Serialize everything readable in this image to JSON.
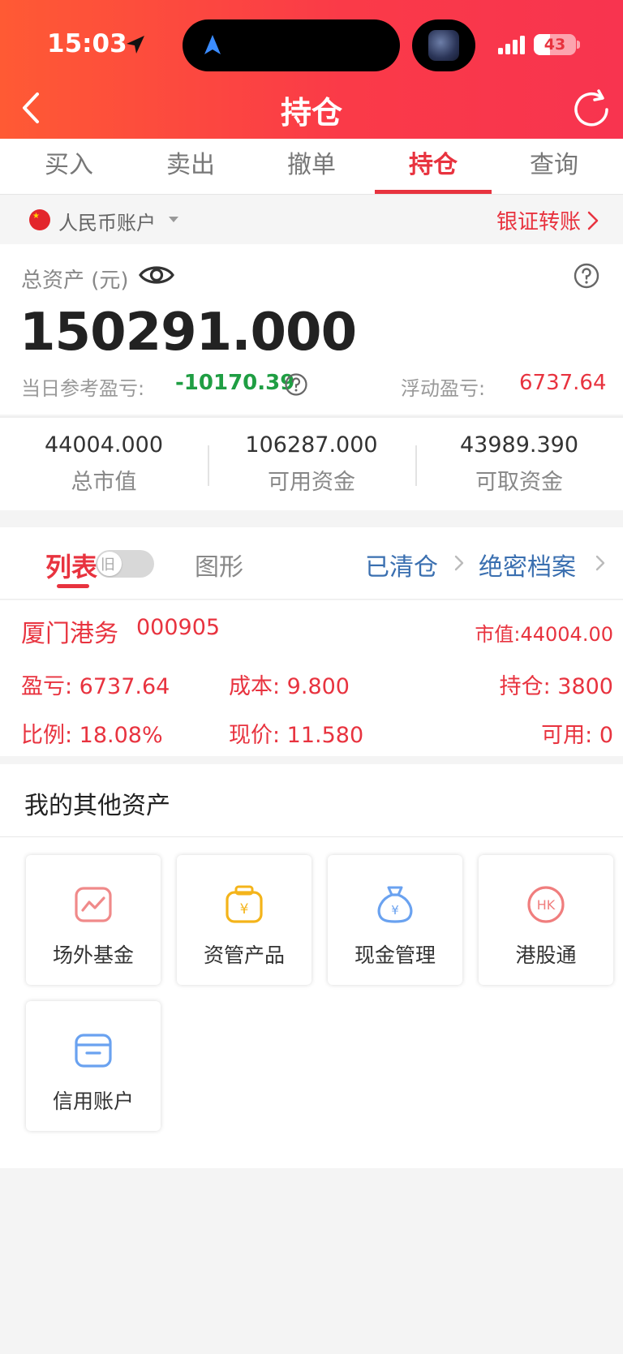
{
  "status_bar": {
    "time": "15:03",
    "battery": "43"
  },
  "header": {
    "title": "持仓"
  },
  "tabs": [
    {
      "label": "买入"
    },
    {
      "label": "卖出"
    },
    {
      "label": "撤单"
    },
    {
      "label": "持仓",
      "active": true
    },
    {
      "label": "查询"
    }
  ],
  "account": {
    "name": "人民币账户",
    "transfer_label": "银证转账"
  },
  "assets": {
    "label": "总资产 (元)",
    "total": "150291.000",
    "daily_pnl_label": "当日参考盈亏:",
    "daily_pnl_value": "-10170.39",
    "floating_pnl_label": "浮动盈亏:",
    "floating_pnl_value": "6737.64"
  },
  "metrics": [
    {
      "value": "44004.000",
      "label": "总市值"
    },
    {
      "value": "106287.000",
      "label": "可用资金"
    },
    {
      "value": "43989.390",
      "label": "可取资金"
    }
  ],
  "list_tabs": {
    "list_label": "列表",
    "toggle_label": "旧",
    "graph_label": "图形",
    "cleared_label": "已清仓",
    "archive_label": "绝密档案"
  },
  "holding": {
    "name": "厦门港务",
    "code": "000905",
    "market_value": "市值:44004.00",
    "pnl": "盈亏: 6737.64",
    "cost": "成本: 9.800",
    "position": "持仓: 3800",
    "ratio": "比例: 18.08%",
    "price": "现价: 11.580",
    "available": "可用: 0"
  },
  "other_assets": {
    "title": "我的其他资产",
    "items": [
      {
        "label": "场外基金",
        "icon": "fund-chart-icon"
      },
      {
        "label": "资管产品",
        "icon": "wallet-yen-icon"
      },
      {
        "label": "现金管理",
        "icon": "money-bag-icon"
      },
      {
        "label": "港股通",
        "icon": "hk-icon"
      },
      {
        "label": "信用账户",
        "icon": "credit-card-icon"
      }
    ]
  },
  "colors": {
    "accent": "#e8333f",
    "green": "#1f9e43",
    "link_blue": "#3a6fb0"
  }
}
